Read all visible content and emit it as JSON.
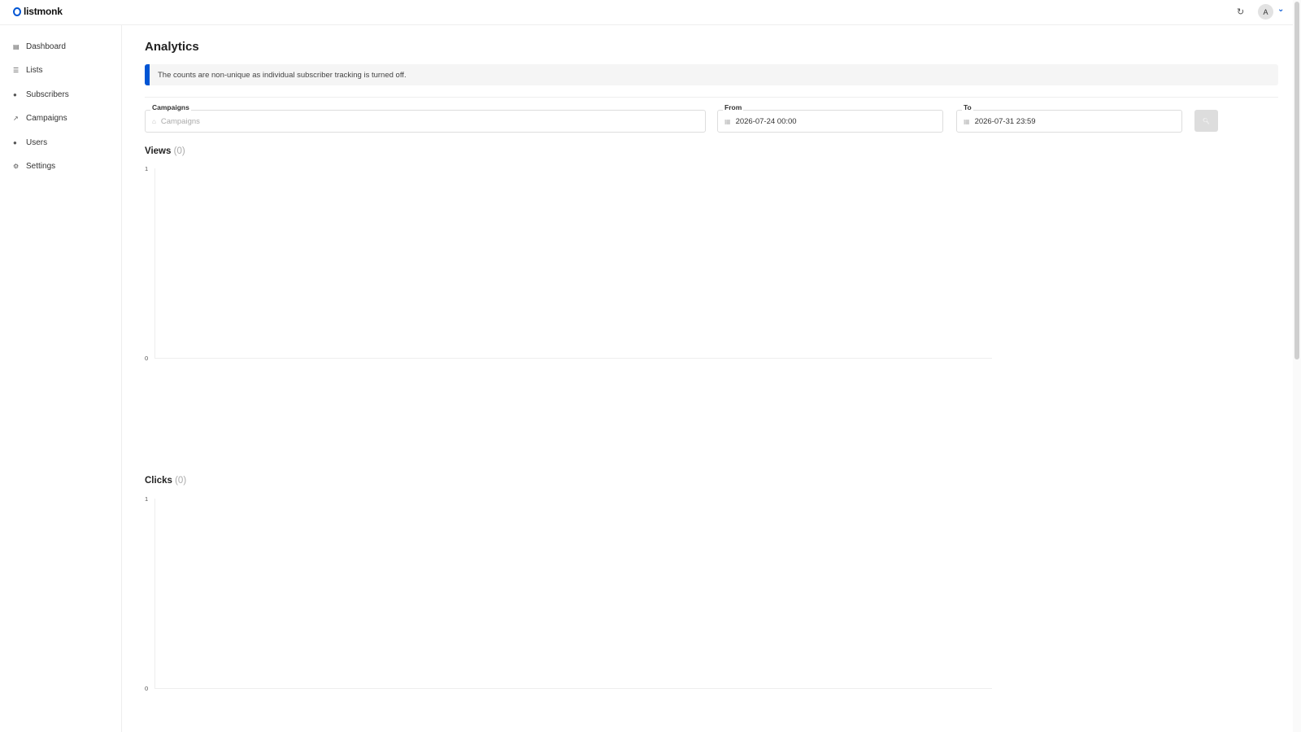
{
  "app": {
    "logo": "listmonk"
  },
  "topbar": {
    "refresh_icon": "refresh-icon",
    "avatar_initial": "A",
    "chevron_icon": "chevron-down-icon"
  },
  "sidebar": {
    "items": [
      {
        "label": "Dashboard",
        "icon": "dashboard-icon"
      },
      {
        "label": "Lists",
        "icon": "list-icon"
      },
      {
        "label": "Subscribers",
        "icon": "users-icon"
      },
      {
        "label": "Campaigns",
        "icon": "rocket-icon"
      },
      {
        "label": "Users",
        "icon": "users-icon"
      },
      {
        "label": "Settings",
        "icon": "gear-icon"
      }
    ]
  },
  "page": {
    "title": "Analytics",
    "notice": "The counts are non-unique as individual subscriber tracking is turned off."
  },
  "filters": {
    "campaigns_label": "Campaigns",
    "campaigns_placeholder": "Campaigns",
    "from_label": "From",
    "from_value": "2026-07-24 00:00",
    "to_label": "To",
    "to_value": "2026-07-31 23:59"
  },
  "chart_data": [
    {
      "type": "line",
      "title": "Views",
      "count": "(0)",
      "x": [],
      "series": [],
      "ylim": [
        0,
        1
      ],
      "yticks": [
        "0",
        "1"
      ]
    },
    {
      "type": "line",
      "title": "Clicks",
      "count": "(0)",
      "x": [],
      "series": [],
      "ylim": [
        0,
        1
      ],
      "yticks": [
        "0",
        "1"
      ]
    }
  ]
}
